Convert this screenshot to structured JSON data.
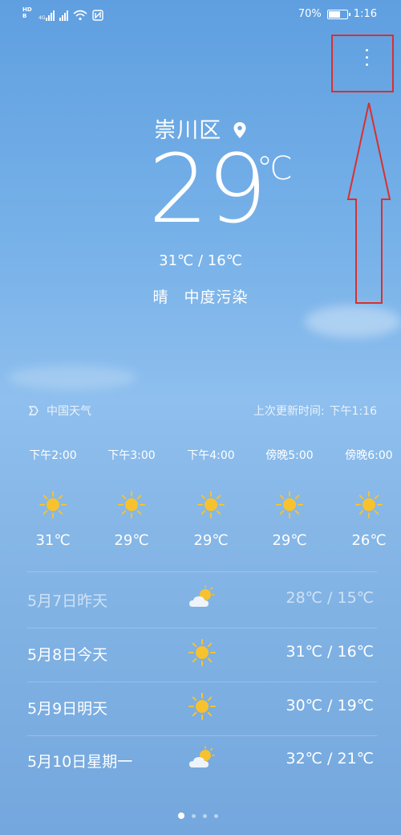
{
  "status_bar": {
    "hd_top": "HD",
    "hd_bottom": "B",
    "net_label_1": "4G",
    "battery_percent": "70%",
    "battery_level": 0.7,
    "time": "1:16"
  },
  "location": {
    "name": "崇川区"
  },
  "current": {
    "temp": "29",
    "unit": "℃",
    "range": "31℃ / 16℃",
    "condition": "晴",
    "air_quality": "中度污染"
  },
  "source": {
    "name": "中国天气",
    "updated_label": "上次更新时间:",
    "updated_time": "下午1:16"
  },
  "hourly": [
    {
      "time": "下午2:00",
      "icon": "sun-icon",
      "temp": "31℃"
    },
    {
      "time": "下午3:00",
      "icon": "sun-icon",
      "temp": "29℃"
    },
    {
      "time": "下午4:00",
      "icon": "sun-icon",
      "temp": "29℃"
    },
    {
      "time": "傍晚5:00",
      "icon": "sun-icon",
      "temp": "29℃"
    },
    {
      "time": "傍晚6:00",
      "icon": "sun-icon",
      "temp": "26℃"
    }
  ],
  "daily": [
    {
      "label": "5月7日昨天",
      "icon": "partly-cloudy-icon",
      "temp": "28℃ / 15℃"
    },
    {
      "label": "5月8日今天",
      "icon": "sun-icon",
      "temp": "31℃ / 16℃"
    },
    {
      "label": "5月9日明天",
      "icon": "sun-icon",
      "temp": "30℃ / 19℃"
    },
    {
      "label": "5月10日星期一",
      "icon": "partly-cloudy-icon",
      "temp": "32℃ / 21℃"
    }
  ],
  "colors": {
    "sun": "#f7c22e",
    "annotation": "#d9302e"
  },
  "pager": {
    "count": 4,
    "active": 0
  }
}
